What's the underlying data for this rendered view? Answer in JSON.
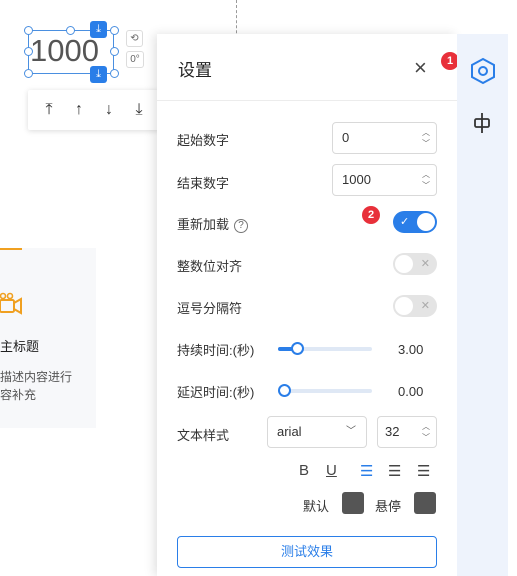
{
  "canvas": {
    "counter_text": "1000",
    "rotate_label": "⟲",
    "angle_label": "0°",
    "layer_icons": [
      "move-to-top-icon",
      "move-up-icon",
      "move-down-icon",
      "move-to-bottom-icon"
    ],
    "card": {
      "title": "主标题",
      "desc_line1": "描述内容进行",
      "desc_line2": "容补充"
    }
  },
  "panel": {
    "title": "设置",
    "close_label": "×",
    "badges": [
      "1",
      "2"
    ],
    "start_number": {
      "label": "起始数字",
      "value": "0"
    },
    "end_number": {
      "label": "结束数字",
      "value": "1000"
    },
    "reload": {
      "label": "重新加载",
      "on": true
    },
    "integer_align": {
      "label": "整数位对齐",
      "on": false
    },
    "comma_sep": {
      "label": "逗号分隔符",
      "on": false
    },
    "duration": {
      "label": "持续时间:(秒)",
      "value": "3.00",
      "fraction": 0.2
    },
    "delay": {
      "label": "延迟时间:(秒)",
      "value": "0.00",
      "fraction": 0.0
    },
    "text_style": {
      "label": "文本样式",
      "font": "arial",
      "size": "32"
    },
    "format_icons": [
      "bold-icon",
      "underline-icon",
      "align-left-icon",
      "align-center-icon",
      "align-right-icon"
    ],
    "default_label": "默认",
    "hover_label": "悬停",
    "test_button": "测试效果"
  },
  "colors": {
    "accent": "#2a7ee8",
    "badge": "#e8303a",
    "swatch": "#555555"
  }
}
